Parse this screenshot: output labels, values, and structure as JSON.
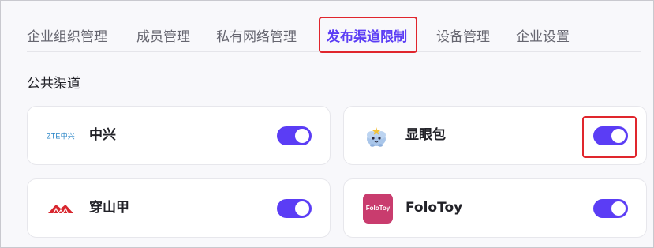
{
  "tabs": [
    {
      "label": "企业组织管理",
      "active": false
    },
    {
      "label": "成员管理",
      "active": false
    },
    {
      "label": "私有网络管理",
      "active": false
    },
    {
      "label": "发布渠道限制",
      "active": true
    },
    {
      "label": "设备管理",
      "active": false
    },
    {
      "label": "企业设置",
      "active": false
    }
  ],
  "section": {
    "title": "公共渠道"
  },
  "channels": [
    {
      "name": "中兴",
      "logo_icon": "zte-logo",
      "logo_text": "ZTE中兴",
      "enabled": true
    },
    {
      "name": "显眼包",
      "logo_icon": "mascot-logo",
      "enabled": true
    },
    {
      "name": "穿山甲",
      "logo_icon": "pangolin-logo",
      "enabled": true
    },
    {
      "name": "FoloToy",
      "logo_icon": "folotoy-logo",
      "logo_text": "FoloToy",
      "enabled": true
    }
  ],
  "colors": {
    "accent": "#5b3df5",
    "highlight": "#e0262d",
    "folotoy": "#c93c6e",
    "zte": "#2a85c7",
    "pangolin": "#d8262e"
  }
}
